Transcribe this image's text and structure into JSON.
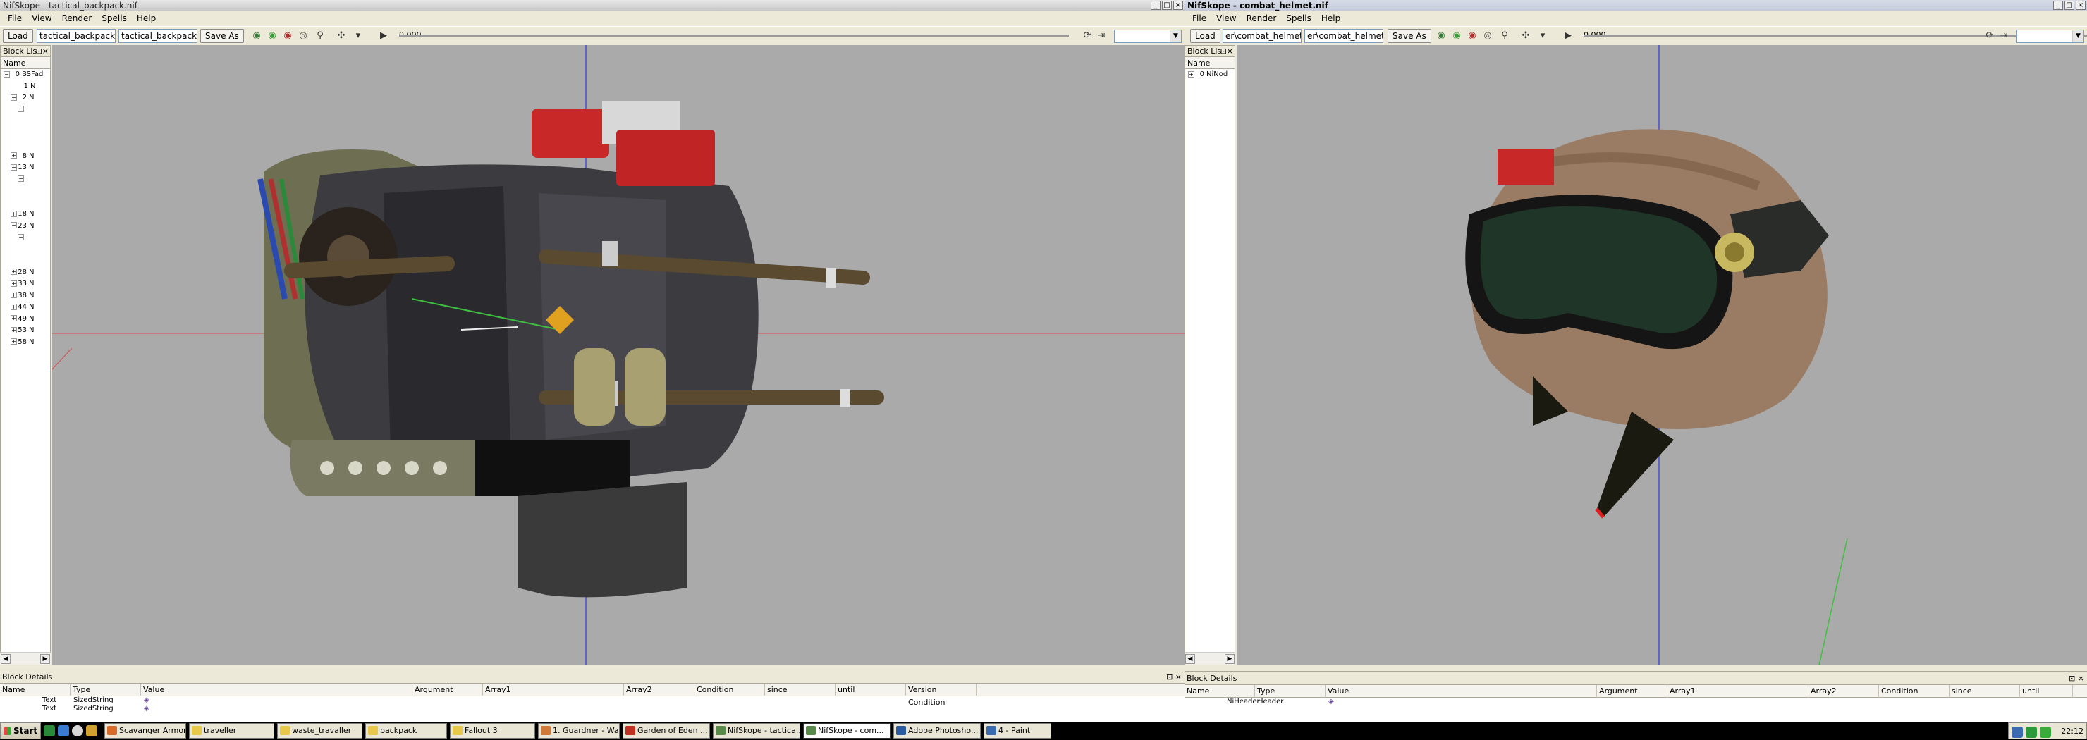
{
  "window1": {
    "title": "NifSkope - tactical_backpack.nif",
    "menu": [
      "File",
      "View",
      "Render",
      "Spells",
      "Help"
    ],
    "toolbar": {
      "load": "Load",
      "path_short": "tactical_backpack.nif",
      "path_full": "tactical_backpack.nif",
      "save_as": "Save As",
      "time": "0.000"
    },
    "block_list": {
      "title": "Block Lis",
      "column": "Name",
      "rows": [
        {
          "num": "0",
          "name": "BSFad",
          "exp": "−",
          "indent": 0
        },
        {
          "num": "1",
          "name": "N",
          "exp": "",
          "indent": 1
        },
        {
          "num": "2",
          "name": "N",
          "exp": "−",
          "indent": 1
        },
        {
          "num": "",
          "name": "",
          "exp": "−",
          "indent": 2
        },
        {
          "num": "",
          "name": "",
          "exp": "",
          "indent": 2
        },
        {
          "num": "",
          "name": "",
          "exp": "",
          "indent": 2
        },
        {
          "num": "",
          "name": "",
          "exp": "",
          "indent": 2
        },
        {
          "num": "8",
          "name": "N",
          "exp": "+",
          "indent": 1
        },
        {
          "num": "13",
          "name": "N",
          "exp": "−",
          "indent": 1
        },
        {
          "num": "",
          "name": "",
          "exp": "−",
          "indent": 2
        },
        {
          "num": "",
          "name": "",
          "exp": "",
          "indent": 2
        },
        {
          "num": "",
          "name": "",
          "exp": "",
          "indent": 2
        },
        {
          "num": "18",
          "name": "N",
          "exp": "+",
          "indent": 1
        },
        {
          "num": "23",
          "name": "N",
          "exp": "−",
          "indent": 1
        },
        {
          "num": "",
          "name": "",
          "exp": "−",
          "indent": 2
        },
        {
          "num": "",
          "name": "",
          "exp": "",
          "indent": 2
        },
        {
          "num": "",
          "name": "",
          "exp": "",
          "indent": 2
        },
        {
          "num": "28",
          "name": "N",
          "exp": "+",
          "indent": 1
        },
        {
          "num": "33",
          "name": "N",
          "exp": "+",
          "indent": 1
        },
        {
          "num": "38",
          "name": "N",
          "exp": "+",
          "indent": 1
        },
        {
          "num": "44",
          "name": "N",
          "exp": "+",
          "indent": 1
        },
        {
          "num": "49",
          "name": "N",
          "exp": "+",
          "indent": 1
        },
        {
          "num": "53",
          "name": "N",
          "exp": "+",
          "indent": 1
        },
        {
          "num": "58",
          "name": "N",
          "exp": "+",
          "indent": 1
        }
      ]
    },
    "block_details": {
      "title": "Block Details",
      "columns": [
        "Name",
        "Type",
        "Value",
        "Argument",
        "Array1",
        "Array2",
        "Condition",
        "since",
        "until",
        "Version Condition"
      ],
      "rows": [
        {
          "name": "Text",
          "type": "SizedString"
        },
        {
          "name": "Text",
          "type": "SizedString"
        }
      ]
    }
  },
  "window2": {
    "title": "NifSkope - combat_helmet.nif",
    "menu": [
      "File",
      "View",
      "Render",
      "Spells",
      "Help"
    ],
    "toolbar": {
      "load": "Load",
      "path_short": "er\\combat_helmet.nif",
      "path_full": "er\\combat_helmet.nif",
      "save_as": "Save As",
      "time": "0.000"
    },
    "block_list": {
      "title": "Block Lis",
      "column": "Name",
      "rows": [
        {
          "num": "0",
          "name": "NiNod",
          "exp": "+",
          "indent": 0
        }
      ]
    },
    "block_details": {
      "title": "Block Details",
      "columns": [
        "Name",
        "Type",
        "Value",
        "Argument",
        "Array1",
        "Array2",
        "Condition",
        "since",
        "until"
      ],
      "rows": [
        {
          "name": "NiHeader",
          "type": "Header"
        }
      ]
    }
  },
  "taskbar": {
    "start": "Start",
    "tasks": [
      {
        "label": "Scavanger Armor...",
        "color": "#d86a2a"
      },
      {
        "label": "traveller",
        "color": "#e8c84a"
      },
      {
        "label": "waste_travaller",
        "color": "#e8c84a"
      },
      {
        "label": "backpack",
        "color": "#e8c84a"
      },
      {
        "label": "Fallout 3",
        "color": "#e8c84a"
      },
      {
        "label": "1. Guardner - Wa...",
        "color": "#d07a3a"
      },
      {
        "label": "Garden of Eden ...",
        "color": "#c03020"
      },
      {
        "label": "NifSkope - tactica...",
        "color": "#5a8a4a"
      },
      {
        "label": "NifSkope - com...",
        "color": "#5a8a4a"
      },
      {
        "label": "Adobe Photosho...",
        "color": "#2a5aa0"
      },
      {
        "label": "4 - Paint",
        "color": "#3a6ab0"
      }
    ],
    "clock": "22:12"
  }
}
